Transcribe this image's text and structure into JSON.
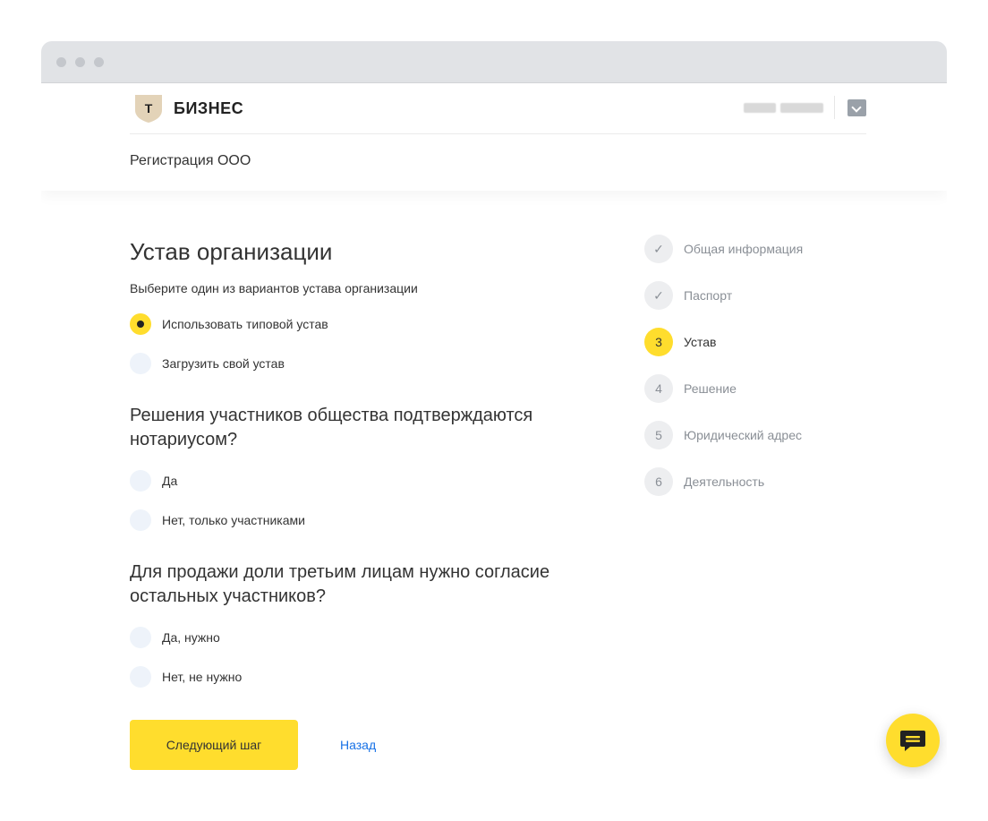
{
  "brand": {
    "logo_letter": "Т",
    "name": "БИЗНЕС",
    "accent_color": "#ffdd2d",
    "link_color": "#1771e6"
  },
  "header": {
    "page_title": "Регистрация ООО",
    "account_icon": "bank-account-icon"
  },
  "form": {
    "title": "Устав организации",
    "subtitle": "Выберите один из вариантов устава организации",
    "charter_options": [
      {
        "label": "Использовать типовой устав",
        "checked": true
      },
      {
        "label": "Загрузить свой устав",
        "checked": false
      }
    ],
    "q1": {
      "title": "Решения участников общества подтверждаются нотариусом?",
      "options": [
        {
          "label": "Да",
          "checked": false
        },
        {
          "label": "Нет, только участниками",
          "checked": false
        }
      ]
    },
    "q2": {
      "title": "Для продажи доли третьим лицам нужно согласие остальных участников?",
      "options": [
        {
          "label": "Да, нужно",
          "checked": false
        },
        {
          "label": "Нет, не нужно",
          "checked": false
        }
      ]
    },
    "next_label": "Следующий шаг",
    "back_label": "Назад"
  },
  "steps": [
    {
      "marker": "✓",
      "label": "Общая информация",
      "state": "done"
    },
    {
      "marker": "✓",
      "label": "Паспорт",
      "state": "done"
    },
    {
      "marker": "3",
      "label": "Устав",
      "state": "active"
    },
    {
      "marker": "4",
      "label": "Решение",
      "state": "pending"
    },
    {
      "marker": "5",
      "label": "Юридический адрес",
      "state": "pending"
    },
    {
      "marker": "6",
      "label": "Деятельность",
      "state": "pending"
    }
  ],
  "chat": {
    "icon": "chat-icon"
  }
}
